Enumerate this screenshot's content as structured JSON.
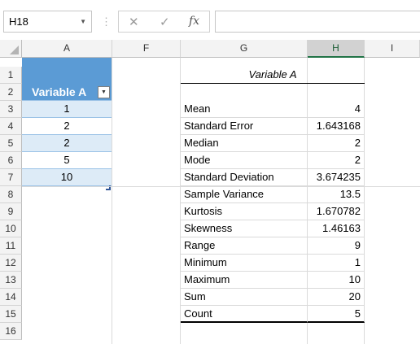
{
  "formula_bar": {
    "name_box": "H18",
    "name_dropdown_icon": "triangle-down",
    "separator": "⋮",
    "cancel_icon": "✕",
    "enter_icon": "✓",
    "fx_label": "fx",
    "formula_value": ""
  },
  "columns": [
    "A",
    "F",
    "G",
    "H",
    "I"
  ],
  "selected_column": "H",
  "rows": [
    "1",
    "2",
    "3",
    "4",
    "5",
    "6",
    "7",
    "8",
    "9",
    "10",
    "11",
    "12",
    "13",
    "14",
    "15",
    "16"
  ],
  "table": {
    "header": "Variable A",
    "values": [
      "1",
      "2",
      "2",
      "5",
      "10"
    ]
  },
  "stats": {
    "title": "Variable A",
    "items": [
      {
        "label": "Mean",
        "value": "4"
      },
      {
        "label": "Standard Error",
        "value": "1.643168"
      },
      {
        "label": "Median",
        "value": "2"
      },
      {
        "label": "Mode",
        "value": "2"
      },
      {
        "label": "Standard Deviation",
        "value": "3.674235"
      },
      {
        "label": "Sample Variance",
        "value": "13.5"
      },
      {
        "label": "Kurtosis",
        "value": "1.670782"
      },
      {
        "label": "Skewness",
        "value": "1.46163"
      },
      {
        "label": "Range",
        "value": "9"
      },
      {
        "label": "Minimum",
        "value": "1"
      },
      {
        "label": "Maximum",
        "value": "10"
      },
      {
        "label": "Sum",
        "value": "20"
      },
      {
        "label": "Count",
        "value": "5"
      }
    ]
  },
  "colors": {
    "table_header": "#5b9bd5",
    "band": "#ddebf7",
    "selected_header_accent": "#217346"
  }
}
